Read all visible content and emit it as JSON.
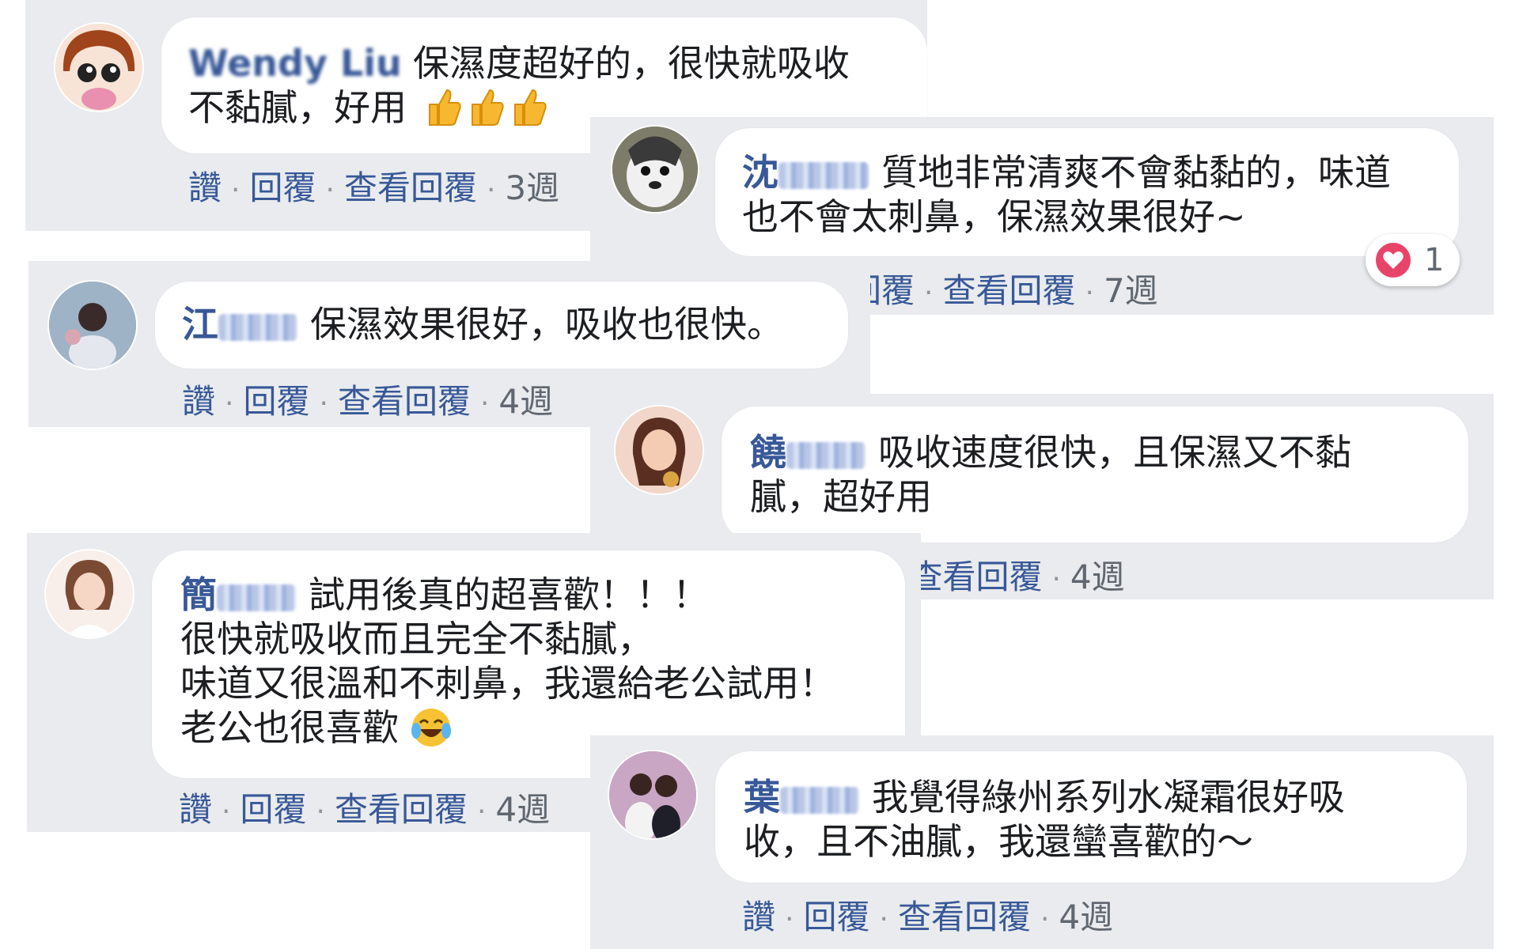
{
  "comments": [
    {
      "name": "Wendy Liu",
      "text_line1": "保濕度超好的，很快就吸收",
      "text_line2": "不黏膩，好用",
      "like": "讚",
      "reply": "回覆",
      "view_replies": "查看回覆",
      "time": "3週"
    },
    {
      "name_prefix": "沈",
      "text_line1": "質地非常清爽不會黏黏的，味道",
      "text_line2": "也不會太刺鼻，保濕效果很好~",
      "reply": "回覆",
      "view_replies": "查看回覆",
      "time": "7週",
      "reaction_count": "1"
    },
    {
      "name_prefix": "江",
      "text_line1": "保濕效果很好，吸收也很快。",
      "like": "讚",
      "reply": "回覆",
      "view_replies": "查看回覆",
      "time": "4週"
    },
    {
      "name_prefix": "饒",
      "text_line1": "吸收速度很快，且保濕又不黏",
      "text_line2": "膩，超好用",
      "view_replies": "查看回覆",
      "time": "4週"
    },
    {
      "name_prefix": "簡",
      "text_line1": "試用後真的超喜歡！！！",
      "text_line2": "很快就吸收而且完全不黏膩，",
      "text_line3": "味道又很溫和不刺鼻，我還給老公試用！",
      "text_line4": "老公也很喜歡",
      "like": "讚",
      "reply": "回覆",
      "view_replies": "查看回覆",
      "time": "4週"
    },
    {
      "name_prefix": "葉",
      "text_line1": "我覺得綠州系列水凝霜很好吸",
      "text_line2": "收，且不油膩，我還蠻喜歡的～",
      "like": "讚",
      "reply": "回覆",
      "view_replies": "查看回覆",
      "time": "4週"
    }
  ],
  "separator": "·",
  "colors": {
    "card_bg": "#e9ebee",
    "name_color": "#385898",
    "meta_color": "#606770",
    "heart": "#e8446a"
  }
}
